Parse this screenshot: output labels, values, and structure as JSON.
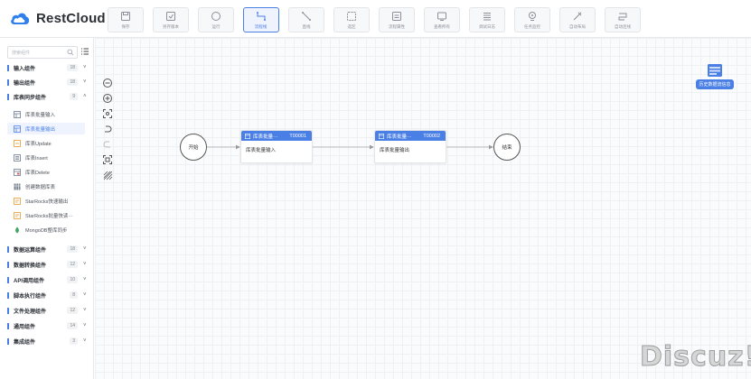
{
  "app": {
    "name": "RestCloud"
  },
  "toolbar": [
    {
      "label": "保存",
      "icon": "save-icon",
      "active": false
    },
    {
      "label": "另存版本",
      "icon": "save-version-icon",
      "active": false
    },
    {
      "label": "运行",
      "icon": "run-icon",
      "active": false
    },
    {
      "label": "流程线",
      "icon": "flow-line-icon",
      "active": true
    },
    {
      "label": "直线",
      "icon": "straight-line-icon",
      "active": false
    },
    {
      "label": "选区",
      "icon": "selection-icon",
      "active": false
    },
    {
      "label": "流程属性",
      "icon": "process-properties-icon",
      "active": false
    },
    {
      "label": "查看所有",
      "icon": "view-all-icon",
      "active": false
    },
    {
      "label": "调试日志",
      "icon": "debug-log-icon",
      "active": false
    },
    {
      "label": "任务监控",
      "icon": "task-monitor-icon",
      "active": false
    },
    {
      "label": "自动布局",
      "icon": "auto-layout-icon",
      "active": false
    },
    {
      "label": "自动连线",
      "icon": "auto-connect-icon",
      "active": false
    }
  ],
  "sidebar": {
    "search_placeholder": "搜索组件",
    "groups": [
      {
        "label": "输入组件",
        "count": "18",
        "expanded": false
      },
      {
        "label": "输出组件",
        "count": "18",
        "expanded": false
      },
      {
        "label": "库表同步组件",
        "count": "9",
        "expanded": true
      },
      {
        "label": "数据运算组件",
        "count": "18",
        "expanded": false
      },
      {
        "label": "数据转换组件",
        "count": "12",
        "expanded": false
      },
      {
        "label": "API调用组件",
        "count": "10",
        "expanded": false
      },
      {
        "label": "脚本执行组件",
        "count": "8",
        "expanded": false
      },
      {
        "label": "文件处理组件",
        "count": "12",
        "expanded": false
      },
      {
        "label": "通用组件",
        "count": "14",
        "expanded": false
      },
      {
        "label": "集成组件",
        "count": "3",
        "expanded": false
      }
    ],
    "items": [
      {
        "label": "库表批量输入",
        "active": false
      },
      {
        "label": "库表批量输出",
        "active": true
      },
      {
        "label": "库表Update",
        "active": false
      },
      {
        "label": "库表Insert",
        "active": false
      },
      {
        "label": "库表Delete",
        "active": false
      },
      {
        "label": "创建数据库表",
        "active": false
      },
      {
        "label": "StarRocks快速输出",
        "active": false
      },
      {
        "label": "StarRocks批量快读···",
        "active": false
      },
      {
        "label": "MongoDB整库同步",
        "active": false
      }
    ]
  },
  "canvas": {
    "start_label": "开始",
    "end_label": "结束",
    "nodes": [
      {
        "title": "库表批量···",
        "id": "T00001",
        "body": "库表批量输入"
      },
      {
        "title": "库表批量···",
        "id": "T00002",
        "body": "库表批量输出"
      }
    ],
    "history_label": "历史数据流信息",
    "accent": "#4a7fe6"
  },
  "watermark": "Discuz!"
}
